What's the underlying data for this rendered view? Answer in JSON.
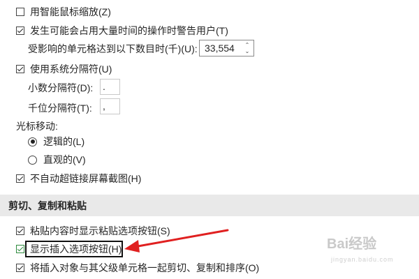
{
  "options": {
    "smart_mouse_zoom": {
      "label": "用智能鼠标缩放(Z)",
      "checked": false
    },
    "alert_time_consuming": {
      "label": "发生可能会占用大量时间的操作时警告用户(T)",
      "checked": true
    },
    "cells_affected_label": "受影响的单元格达到以下数目时(千)(U):",
    "cells_affected_value": "33,554",
    "use_system_separators": {
      "label": "使用系统分隔符(U)",
      "checked": true
    },
    "decimal_separator_label": "小数分隔符(D):",
    "decimal_separator_value": ".",
    "thousands_separator_label": "千位分隔符(T):",
    "thousands_separator_value": ",",
    "cursor_movement_label": "光标移动:",
    "logical_radio": {
      "label": "逻辑的(L)",
      "selected": true
    },
    "visual_radio": {
      "label": "直观的(V)",
      "selected": false
    },
    "no_auto_hyperlink": {
      "label": "不自动超链接屏幕截图(H)",
      "checked": true
    }
  },
  "cut_copy_paste": {
    "header": "剪切、复制和粘贴",
    "show_paste_options": {
      "label": "粘贴内容时显示粘贴选项按钮(S)",
      "checked": true
    },
    "show_insert_options": {
      "label": "显示插入选项按钮(H)",
      "checked": true
    },
    "cut_copy_sort_objects": {
      "label": "将插入对象与其父级单元格一起剪切、复制和排序(O)",
      "checked": true
    }
  },
  "annotation": {
    "arrow_color": "#e02020"
  },
  "watermark": {
    "brand": "Bai经验",
    "sub": "jingyan.baidu.com"
  }
}
